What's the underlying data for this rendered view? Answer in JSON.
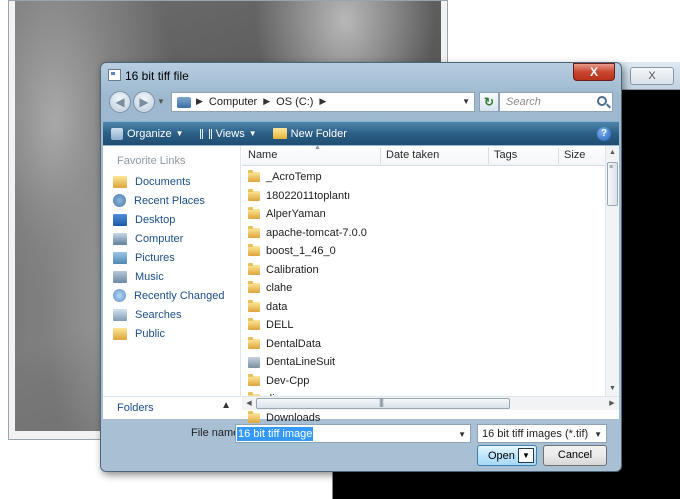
{
  "background": {
    "right_window_close": "X"
  },
  "dialog": {
    "title": "16 bit tiff file",
    "close": "X",
    "address": {
      "crumbs": [
        "Computer",
        "OS (C:)"
      ]
    },
    "search": {
      "placeholder": "Search"
    },
    "toolbar": {
      "organize": "Organize",
      "views": "Views",
      "new_folder": "New Folder",
      "help": "?"
    },
    "sidebar": {
      "title": "Favorite Links",
      "items": [
        {
          "label": "Documents",
          "icon": "documents-folder-icon"
        },
        {
          "label": "Recent Places",
          "icon": "recent-places-icon"
        },
        {
          "label": "Desktop",
          "icon": "desktop-icon"
        },
        {
          "label": "Computer",
          "icon": "computer-icon"
        },
        {
          "label": "Pictures",
          "icon": "pictures-icon"
        },
        {
          "label": "Music",
          "icon": "music-icon"
        },
        {
          "label": "Recently Changed",
          "icon": "recently-changed-icon"
        },
        {
          "label": "Searches",
          "icon": "searches-icon"
        },
        {
          "label": "Public",
          "icon": "public-folder-icon"
        }
      ],
      "folders_label": "Folders"
    },
    "columns": [
      "Name",
      "Date taken",
      "Tags",
      "Size"
    ],
    "files": [
      {
        "name": "_AcroTemp",
        "type": "folder"
      },
      {
        "name": "18022011toplantı",
        "type": "folder"
      },
      {
        "name": "AlperYaman",
        "type": "folder"
      },
      {
        "name": "apache-tomcat-7.0.0",
        "type": "folder"
      },
      {
        "name": "boost_1_46_0",
        "type": "folder"
      },
      {
        "name": "Calibration",
        "type": "folder"
      },
      {
        "name": "clahe",
        "type": "folder"
      },
      {
        "name": "data",
        "type": "folder"
      },
      {
        "name": "DELL",
        "type": "folder"
      },
      {
        "name": "DentalData",
        "type": "folder"
      },
      {
        "name": "DentaLineSuit",
        "type": "app-folder"
      },
      {
        "name": "Dev-Cpp",
        "type": "folder"
      },
      {
        "name": "dis_xray",
        "type": "folder"
      },
      {
        "name": "Downloads",
        "type": "folder"
      }
    ],
    "filename": {
      "label": "File name:",
      "value": "16 bit tiff image"
    },
    "filetype": {
      "value": "16 bit tiff images (*.tif)"
    },
    "buttons": {
      "open": "Open",
      "cancel": "Cancel"
    }
  }
}
